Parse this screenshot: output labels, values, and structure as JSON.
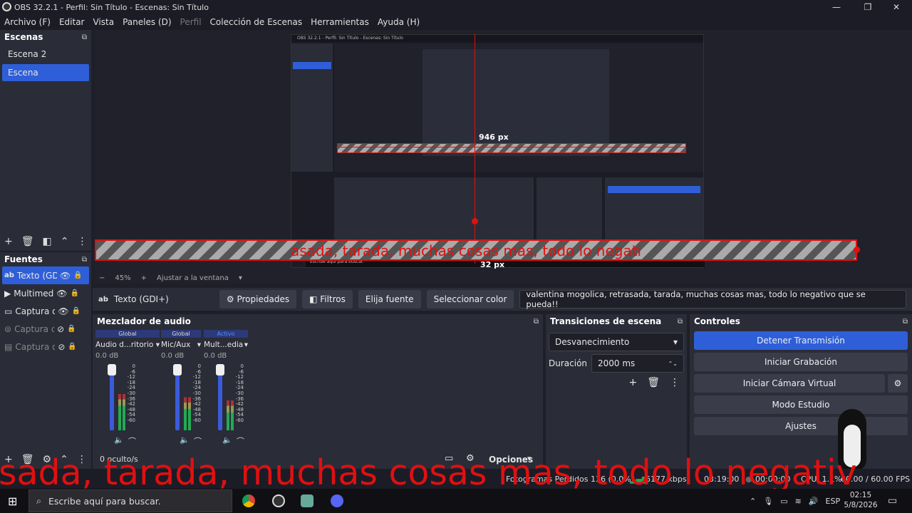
{
  "window": {
    "title": "OBS 32.2.1 - Perfil: Sin Título - Escenas: Sin Título"
  },
  "menu": [
    "Archivo (F)",
    "Editar",
    "Vista",
    "Paneles (D)",
    "Perfil",
    "Colección de Escenas",
    "Herramientas",
    "Ayuda (H)"
  ],
  "scenes": {
    "title": "Escenas",
    "items": [
      "Escena 2",
      "Escena"
    ],
    "selected": 1
  },
  "sources": {
    "title": "Fuentes",
    "items": [
      {
        "name": "Texto (GD",
        "visible": true,
        "selected": true
      },
      {
        "name": "Multimed",
        "visible": true,
        "selected": false
      },
      {
        "name": "Captura d",
        "visible": true,
        "selected": false
      },
      {
        "name": "Captura d",
        "visible": false,
        "selected": false
      },
      {
        "name": "Captura d",
        "visible": false,
        "selected": false
      }
    ],
    "hidden_count": "0 oculto/s"
  },
  "preview": {
    "overlay_text": "asada, tarada, muchas cosas mas, todo lo negati",
    "measure_h": "946 px",
    "measure_v": "32 px",
    "zoom": "45%",
    "fit_label": "Ajustar a la ventana",
    "nested_title": "OBS 32.2.1 - Perfil: Sin Título - Escenas: Sin Título",
    "nested_search": "Escribe aquí para buscar."
  },
  "source_bar": {
    "source_name": "Texto (GDI+)",
    "properties": "Propiedades",
    "filters": "Filtros",
    "choose_font": "Elija fuente",
    "choose_color": "Seleccionar color",
    "text_value": "valentina mogolica, retrasada, tarada, muchas cosas mas, todo lo negativo que se pueda!!"
  },
  "mixer": {
    "title": "Mezclador de audio",
    "channels": [
      {
        "header": "Global",
        "name": "Audio d...ritorio",
        "db": "0.0 dB",
        "level": 0.55
      },
      {
        "header": "Global",
        "name": "Mic/Aux",
        "db": "0.0 dB",
        "level": 0.5
      },
      {
        "header": "Activo",
        "name": "Mult...edia",
        "db": "0.0 dB",
        "level": 0.45
      }
    ],
    "scale": [
      "0",
      "-6",
      "-12",
      "-18",
      "-24",
      "-30",
      "-36",
      "-42",
      "-48",
      "-54",
      "-60"
    ]
  },
  "transitions": {
    "title": "Transiciones de escena",
    "type": "Desvanecimiento",
    "duration_label": "Duración",
    "duration": "2000 ms"
  },
  "controls": {
    "title": "Controles",
    "buttons": [
      "Detener Transmisión",
      "Iniciar Grabación",
      "Iniciar Cámara Virtual",
      "Modo Estudio",
      "Ajustes"
    ]
  },
  "bottom": {
    "options": "Opciones"
  },
  "overlay_bottom": "sada, tarada, muchas cosas mas, todo lo negativ",
  "status": {
    "dropped": "Fotogramas Perdidos 136 (0.0%)",
    "kbps": "6177 kbps",
    "live_time": "03:19:00",
    "rec_time": "00:00:00",
    "cpu": "CPU: 1.1%",
    "fps": "60.00 / 60.00 FPS"
  },
  "taskbar": {
    "search": "Escribe aquí para buscar.",
    "lang": "ESP",
    "time": "02:15",
    "date": "5/8/2026"
  },
  "colors": {
    "accent": "#2f5fd8",
    "overlay": "#e01010",
    "panel": "#2a2c37",
    "bg": "#1e1f29"
  }
}
